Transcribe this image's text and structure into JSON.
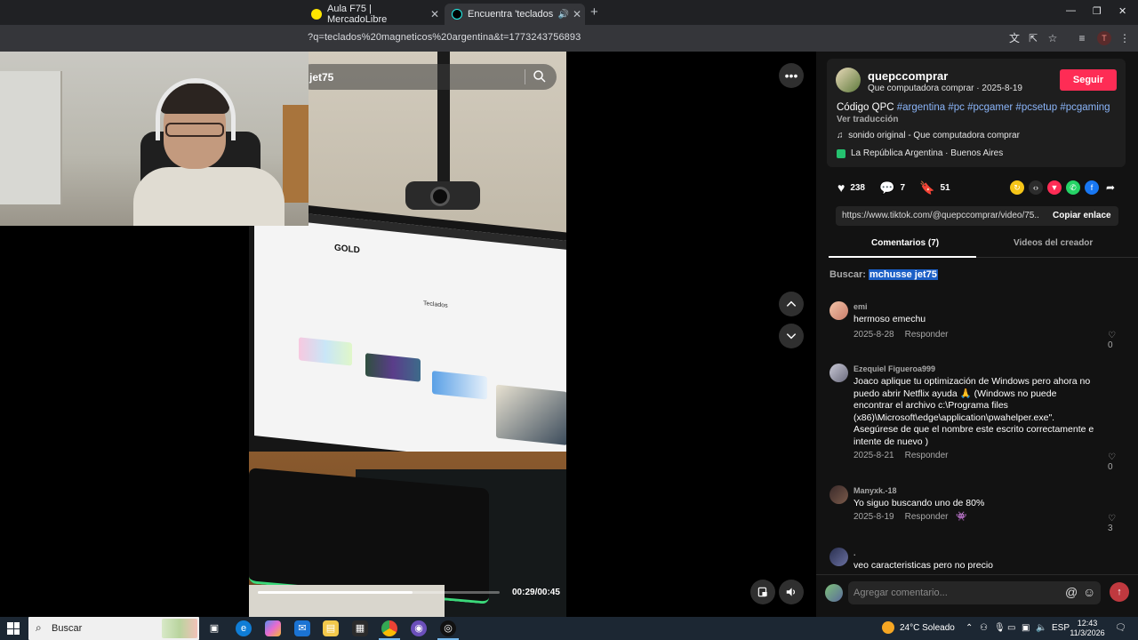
{
  "browser": {
    "tabs": [
      {
        "title": "Aula F75 | MercadoLibre",
        "audio": false
      },
      {
        "title": "Encuentra 'teclados magnet",
        "audio": true
      }
    ],
    "url": "?q=teclados%20magneticos%20argentina&t=1773243756893"
  },
  "video": {
    "search_text": "jet75",
    "time": "00:29/00:45",
    "progress": 0.64,
    "screen_logo": "GOLD",
    "screen_heading": "Teclados"
  },
  "creator": {
    "username": "quepccomprar",
    "nickname_date": "Que computadora comprar · 2025-8-19",
    "follow_label": "Seguir",
    "description_prefix": "Código QPC ",
    "hashtags": [
      "#argentina",
      "#pc",
      "#pcgamer",
      "#pcsetup",
      "#pcgaming"
    ],
    "translate_label": "Ver traducción",
    "music": "sonido original - Que computadora comprar",
    "location": "La República Argentina · Buenos Aires"
  },
  "stats": {
    "likes": "238",
    "comments": "7",
    "saves": "51"
  },
  "share": {
    "link": "https://www.tiktok.com/@quepccomprar/video/75...",
    "copy_label": "Copiar enlace"
  },
  "tabs": {
    "comments": "Comentarios (7)",
    "creator_videos": "Videos del creador"
  },
  "search_hint": {
    "prefix": "Buscar:",
    "query": "mchusse jet75"
  },
  "comments": [
    {
      "name": "emi",
      "text": "hermoso emechu",
      "date": "2025-8-28",
      "reply": "Responder",
      "likes": "0"
    },
    {
      "name": "Ezequiel Figueroa999",
      "text": "Joaco aplique tu optimización de Windows pero ahora no puedo abrir Netflix ayuda 🙏 (Windows no puede encontrar el archivo c:\\Programa files (x86)\\Microsoft\\edge\\application\\pwahelper.exe\". Asegúrese de que el nombre este escrito correctamente e intente de nuevo )",
      "date": "2025-8-21",
      "reply": "Responder",
      "likes": "0"
    },
    {
      "name": "Manyxk.-18",
      "text": "Yo siguo buscando uno de 80%",
      "date": "2025-8-19",
      "reply": "Responder",
      "likes": "3"
    },
    {
      "name": ".",
      "text": "veo caracteristicas pero no precio",
      "date": "",
      "reply": "",
      "likes": ""
    }
  ],
  "composer": {
    "placeholder": "Agregar comentario..."
  },
  "taskbar": {
    "search_label": "Buscar",
    "weather": "24°C  Soleado",
    "language": "ESP",
    "time": "12:43",
    "date": "11/3/2026"
  },
  "colors": {
    "accent": "#fe2c55",
    "hashtag": "#8ab4f8",
    "highlight": "#1b5fc6"
  }
}
